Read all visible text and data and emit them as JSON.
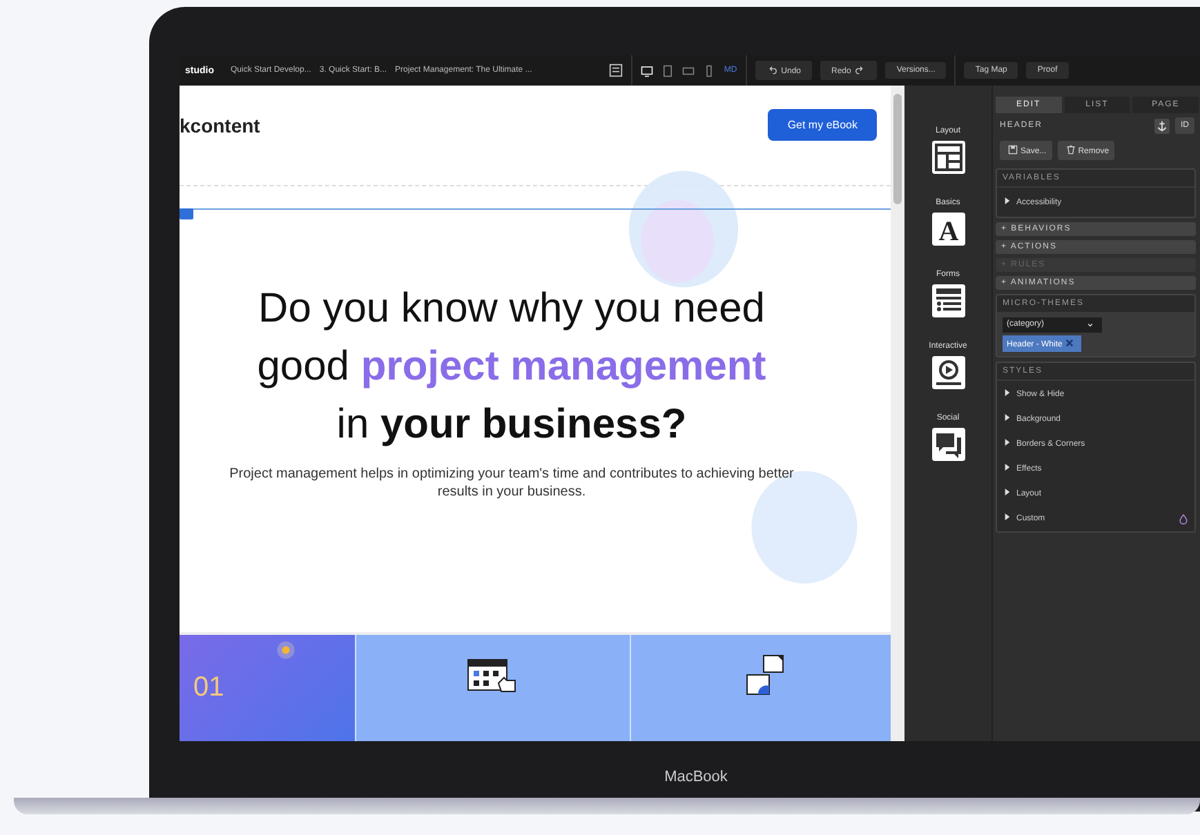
{
  "toolbar": {
    "app_name": "studio",
    "breadcrumbs": [
      "Quick Start Develop...",
      "3. Quick Start: B...",
      "Project Management: The Ultimate ..."
    ],
    "devices": [
      {
        "kind": "desktop",
        "selected": true
      },
      {
        "kind": "tablet",
        "selected": false
      },
      {
        "kind": "landscape",
        "selected": false
      },
      {
        "kind": "phone",
        "selected": false
      }
    ],
    "breakpoint": "MD",
    "undo": "Undo",
    "redo": "Redo",
    "versions": "Versions...",
    "tag_map": "Tag Map",
    "proof": "Proof"
  },
  "canvas": {
    "logo": "kcontent",
    "cta": "Get my eBook",
    "headline": [
      [
        {
          "text": "Do you know why you need",
          "kind": "plain"
        }
      ],
      [
        {
          "text": "good ",
          "kind": "plain"
        },
        {
          "text": "project management",
          "kind": "accent"
        }
      ],
      [
        {
          "text": "in ",
          "kind": "plain"
        },
        {
          "text": "your business?",
          "kind": "strong"
        }
      ]
    ],
    "subtitle": "Project management helps in optimizing your team's time and contributes to achieving better results in your business.",
    "cards": [
      {
        "kind": "number",
        "number": "01"
      },
      {
        "kind": "calendar"
      },
      {
        "kind": "puzzle"
      }
    ]
  },
  "widgets": [
    {
      "label": "Layout",
      "kind": "layout"
    },
    {
      "label": "Basics",
      "kind": "text",
      "glyph": "A"
    },
    {
      "label": "Forms",
      "kind": "form"
    },
    {
      "label": "Interactive",
      "kind": "play"
    },
    {
      "label": "Social",
      "kind": "chat"
    }
  ],
  "inspector": {
    "tabs": [
      {
        "label": "EDIT",
        "selected": true
      },
      {
        "label": "LIST",
        "selected": false
      },
      {
        "label": "PAGE",
        "selected": false
      }
    ],
    "element": "HEADER",
    "id_button": "ID",
    "save": "Save...",
    "remove": "Remove",
    "variables": {
      "title": "VARIABLES",
      "items": [
        "Accessibility"
      ]
    },
    "sections": [
      {
        "label": "+ BEHAVIORS",
        "disabled": false
      },
      {
        "label": "+ ACTIONS",
        "disabled": false
      },
      {
        "label": "+ RULES",
        "disabled": true
      },
      {
        "label": "+ ANIMATIONS",
        "disabled": false
      }
    ],
    "micro_themes": {
      "title": "MICRO-THEMES",
      "select": "(category)",
      "tag": "Header - White"
    },
    "styles": {
      "title": "STYLES",
      "items": [
        {
          "label": "Show & Hide",
          "custom": false
        },
        {
          "label": "Background",
          "custom": false
        },
        {
          "label": "Borders & Corners",
          "custom": false
        },
        {
          "label": "Effects",
          "custom": false
        },
        {
          "label": "Layout",
          "custom": false
        },
        {
          "label": "Custom",
          "custom": true
        }
      ]
    }
  },
  "device_label": "MacBook"
}
